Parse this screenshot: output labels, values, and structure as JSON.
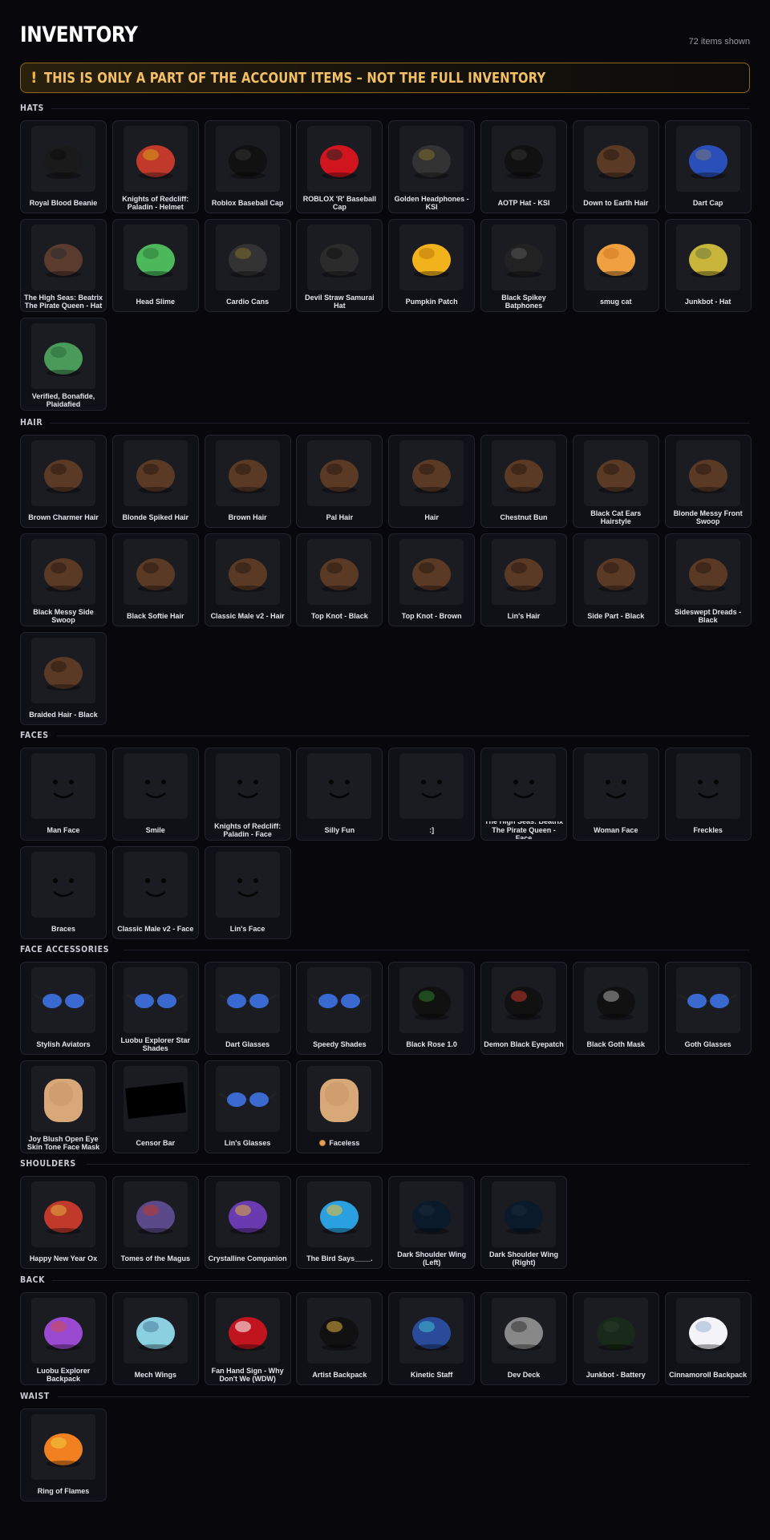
{
  "page": {
    "title": "INVENTORY",
    "count": "72 items shown"
  },
  "warning": {
    "icon": "!",
    "text": "THIS IS ONLY A PART OF THE ACCOUNT ITEMS – NOT THE FULL INVENTORY"
  },
  "sections": [
    {
      "title": "HATS",
      "items": [
        {
          "name": "Royal Blood Beanie",
          "icon": "beanie-icon"
        },
        {
          "name": "Knights of Redcliff: Paladin - Helmet",
          "icon": "helmet-icon"
        },
        {
          "name": "Roblox Baseball Cap",
          "icon": "cap-icon"
        },
        {
          "name": "ROBLOX 'R' Baseball Cap",
          "icon": "red-cap-icon"
        },
        {
          "name": "Golden Headphones - KSI",
          "icon": "headphones-icon"
        },
        {
          "name": "AOTP Hat - KSI",
          "icon": "cap-icon"
        },
        {
          "name": "Down to Earth Hair",
          "icon": "hair-icon"
        },
        {
          "name": "Dart Cap",
          "icon": "dart-cap-icon"
        },
        {
          "name": "The High Seas: Beatrix The Pirate Queen - Hat",
          "icon": "pirate-hat-icon"
        },
        {
          "name": "Head Slime",
          "icon": "slime-icon"
        },
        {
          "name": "Cardio Cans",
          "icon": "headphones-icon"
        },
        {
          "name": "Devil Straw Samurai Hat",
          "icon": "straw-hat-icon"
        },
        {
          "name": "Pumpkin Patch",
          "icon": "pumpkin-icon"
        },
        {
          "name": "Black Spikey Batphones",
          "icon": "batphones-icon"
        },
        {
          "name": "smug cat",
          "icon": "cat-icon"
        },
        {
          "name": "Junkbot - Hat",
          "icon": "junkbot-hat-icon"
        },
        {
          "name": "Verified, Bonafide, Plaidafied",
          "icon": "plaid-cap-icon"
        }
      ]
    },
    {
      "title": "HAIR",
      "items": [
        {
          "name": "Brown Charmer Hair",
          "icon": "hair-icon"
        },
        {
          "name": "Blonde Spiked Hair",
          "icon": "hair-icon"
        },
        {
          "name": "Brown Hair",
          "icon": "hair-icon"
        },
        {
          "name": "Pal Hair",
          "icon": "hair-icon"
        },
        {
          "name": "Hair",
          "icon": "hair-icon"
        },
        {
          "name": "Chestnut Bun",
          "icon": "hair-icon"
        },
        {
          "name": "Black Cat Ears Hairstyle",
          "icon": "hair-icon"
        },
        {
          "name": "Blonde Messy Front Swoop",
          "icon": "hair-icon"
        },
        {
          "name": "Black Messy Side Swoop",
          "icon": "hair-icon"
        },
        {
          "name": "Black Softie Hair",
          "icon": "hair-icon"
        },
        {
          "name": "Classic Male v2 - Hair",
          "icon": "hair-icon"
        },
        {
          "name": "Top Knot - Black",
          "icon": "hair-icon"
        },
        {
          "name": "Top Knot - Brown",
          "icon": "hair-icon"
        },
        {
          "name": "Lin's Hair",
          "icon": "hair-icon"
        },
        {
          "name": "Side Part - Black",
          "icon": "hair-icon"
        },
        {
          "name": "Sideswept Dreads - Black",
          "icon": "hair-icon"
        },
        {
          "name": "Braided Hair - Black",
          "icon": "hair-icon"
        }
      ]
    },
    {
      "title": "FACES",
      "items": [
        {
          "name": "Man Face",
          "icon": "face-icon"
        },
        {
          "name": "Smile",
          "icon": "face-icon"
        },
        {
          "name": "Knights of Redcliff: Paladin - Face",
          "icon": "face-icon"
        },
        {
          "name": "Silly Fun",
          "icon": "face-icon"
        },
        {
          "name": ":]",
          "icon": "face-icon"
        },
        {
          "name": "The High Seas: Beatrix The Pirate Queen - Face",
          "icon": "face-icon"
        },
        {
          "name": "Woman Face",
          "icon": "face-icon"
        },
        {
          "name": "Freckles",
          "icon": "face-icon"
        },
        {
          "name": "Braces",
          "icon": "face-icon"
        },
        {
          "name": "Classic Male v2 - Face",
          "icon": "face-icon"
        },
        {
          "name": "Lin's Face",
          "icon": "face-icon"
        }
      ]
    },
    {
      "title": "FACE ACCESSORIES",
      "items": [
        {
          "name": "Stylish Aviators",
          "icon": "glasses-icon"
        },
        {
          "name": "Luobu Explorer Star Shades",
          "icon": "glasses-icon"
        },
        {
          "name": "Dart Glasses",
          "icon": "glasses-icon"
        },
        {
          "name": "Speedy Shades",
          "icon": "glasses-icon"
        },
        {
          "name": "Black Rose 1.0",
          "icon": "rose-icon"
        },
        {
          "name": "Demon Black Eyepatch",
          "icon": "eyepatch-icon"
        },
        {
          "name": "Black Goth Mask",
          "icon": "mask-icon"
        },
        {
          "name": "Goth Glasses",
          "icon": "glasses-icon"
        },
        {
          "name": "Joy Blush Open Eye Skin Tone Face Mask",
          "icon": "head-mask-icon"
        },
        {
          "name": "Censor Bar",
          "icon": "censor-bar-icon"
        },
        {
          "name": "Lin's Glasses",
          "icon": "glasses-icon"
        },
        {
          "name": "Faceless",
          "icon": "head-mask-icon",
          "badge": "coin-icon"
        }
      ]
    },
    {
      "title": "SHOULDERS",
      "items": [
        {
          "name": "Happy New Year Ox",
          "icon": "ox-icon"
        },
        {
          "name": "Tomes of the Magus",
          "icon": "tomes-icon"
        },
        {
          "name": "Crystalline Companion",
          "icon": "companion-icon"
        },
        {
          "name": "The Bird Says____.",
          "icon": "bird-icon"
        },
        {
          "name": "Dark Shoulder Wing (Left)",
          "icon": "wing-icon"
        },
        {
          "name": "Dark Shoulder Wing (Right)",
          "icon": "wing-icon"
        }
      ]
    },
    {
      "title": "BACK",
      "items": [
        {
          "name": "Luobu Explorer Backpack",
          "icon": "balloon-backpack-icon"
        },
        {
          "name": "Mech Wings",
          "icon": "mech-wings-icon"
        },
        {
          "name": "Fan Hand Sign - Why Don't We (WDW)",
          "icon": "foam-hand-icon"
        },
        {
          "name": "Artist Backpack",
          "icon": "backpack-icon"
        },
        {
          "name": "Kinetic Staff",
          "icon": "staff-icon"
        },
        {
          "name": "Dev Deck",
          "icon": "keyboard-icon"
        },
        {
          "name": "Junkbot - Battery",
          "icon": "battery-icon"
        },
        {
          "name": "Cinnamoroll Backpack",
          "icon": "cinnamoroll-icon"
        }
      ]
    },
    {
      "title": "WAIST",
      "items": [
        {
          "name": "Ring of Flames",
          "icon": "flames-icon"
        }
      ]
    }
  ]
}
